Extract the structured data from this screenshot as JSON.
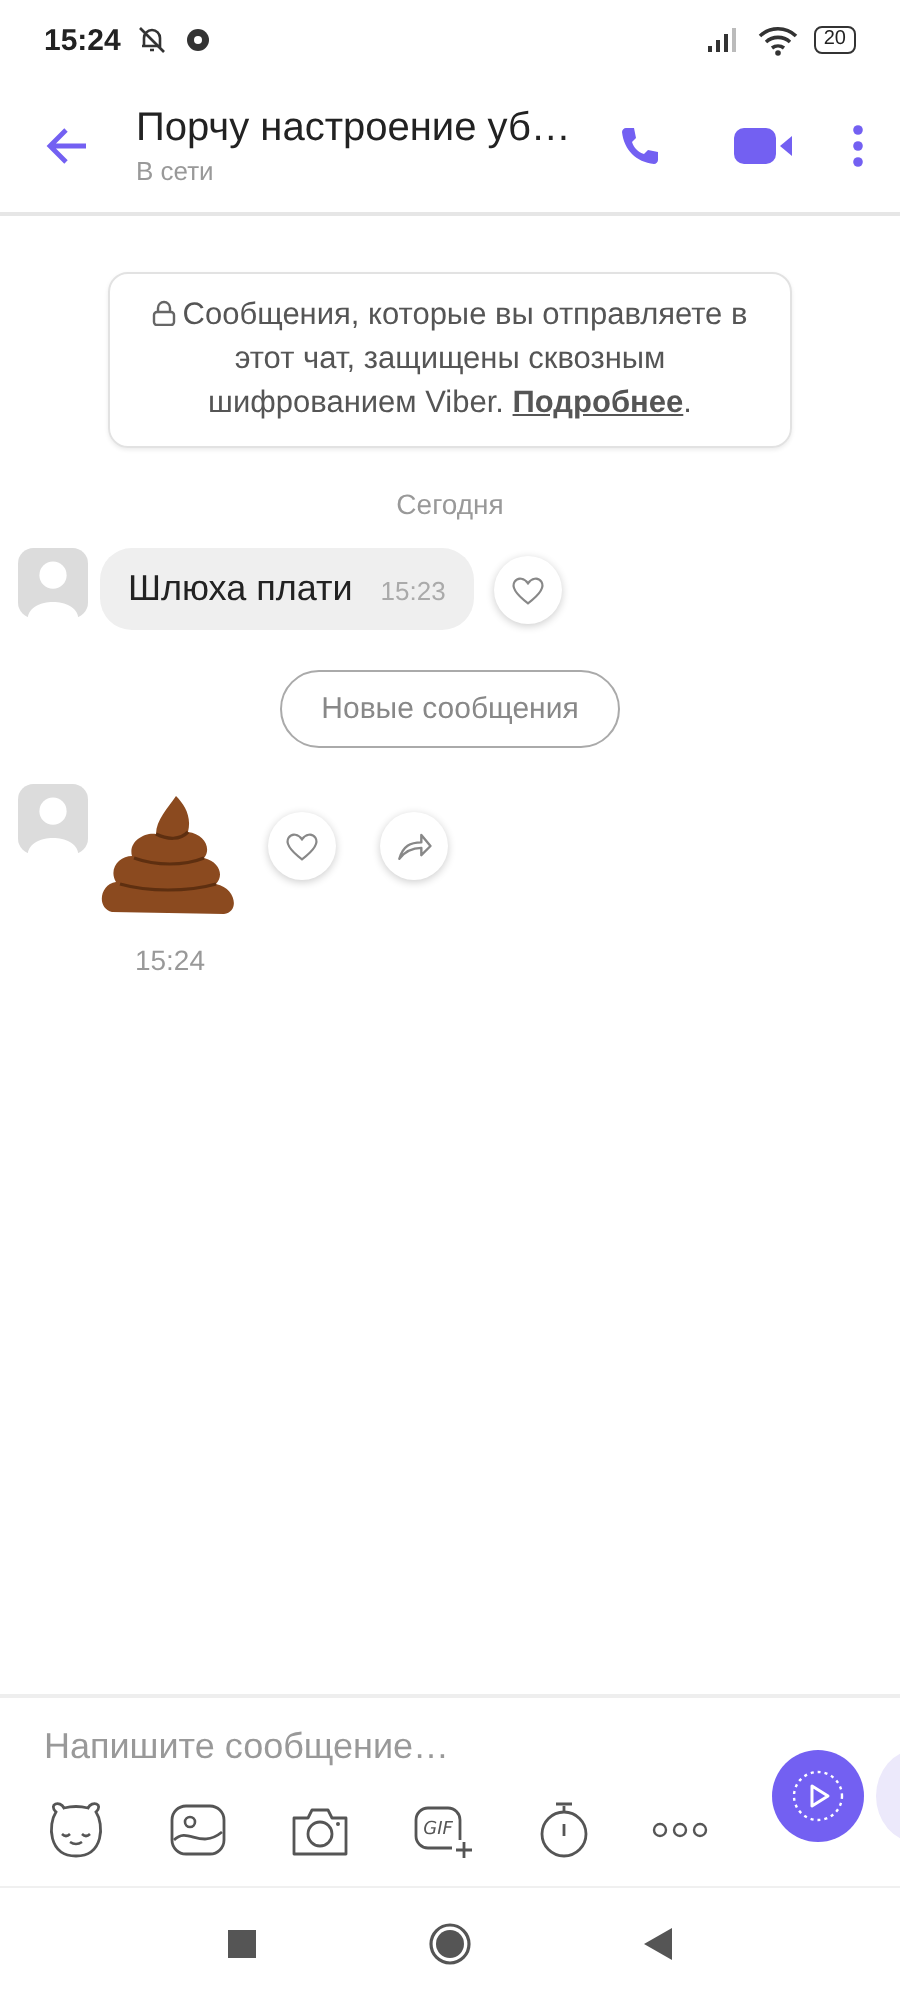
{
  "status_bar": {
    "time": "15:24",
    "battery": "20"
  },
  "header": {
    "title": "Порчу настроение уб…",
    "subtitle": "В сети"
  },
  "encryption_notice": {
    "text": "Сообщения, которые вы отправляете в этот чат, защищены сквозным шифрованием Viber. ",
    "link": "Подробнее",
    "text_after": "."
  },
  "date_divider": "Сегодня",
  "messages": [
    {
      "kind": "text",
      "text": "Шлюха плати",
      "time": "15:23"
    },
    {
      "kind": "new_divider",
      "label": "Новые сообщения"
    },
    {
      "kind": "sticker",
      "time": "15:24"
    }
  ],
  "composer": {
    "placeholder": "Напишите сообщение…",
    "gif_label": "GIF"
  }
}
